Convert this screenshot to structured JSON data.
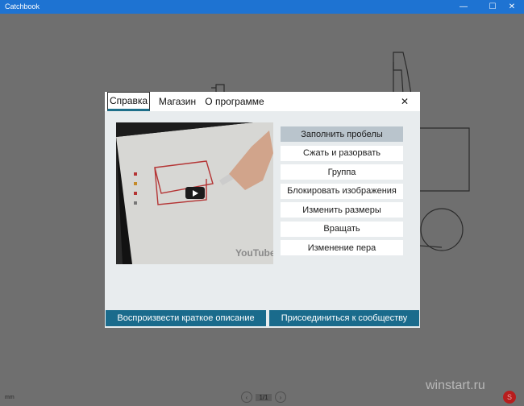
{
  "window": {
    "title": "Catchbook",
    "minimize_glyph": "—",
    "maximize_glyph": "☐",
    "close_glyph": "✕"
  },
  "dialog": {
    "tabs": [
      "Справка",
      "Магазин",
      "О программе"
    ],
    "active_tab": "Справка",
    "close_glyph": "✕",
    "video": {
      "provider_label": "YouTube",
      "play_icon": "play-icon"
    },
    "help_items": [
      "Заполнить пробелы",
      "Сжать и разорвать",
      "Группа",
      "Блокировать изображения",
      "Изменить размеры",
      "Вращать",
      "Изменение пера"
    ],
    "selected_item": "Заполнить пробелы",
    "play_overview_label": "Воспроизвести краткое описание",
    "join_community_label": "Присоединиться к сообществу"
  },
  "statusbar": {
    "unit": "mm",
    "page_indicator": "1/1",
    "prev_glyph": "‹",
    "next_glyph": "›"
  },
  "watermark": "winstart.ru",
  "colors": {
    "titlebar": "#1e73d2",
    "accent": "#1a6b8c",
    "selected_item": "#b9c4cc",
    "overlay": "#6f6f6f"
  }
}
